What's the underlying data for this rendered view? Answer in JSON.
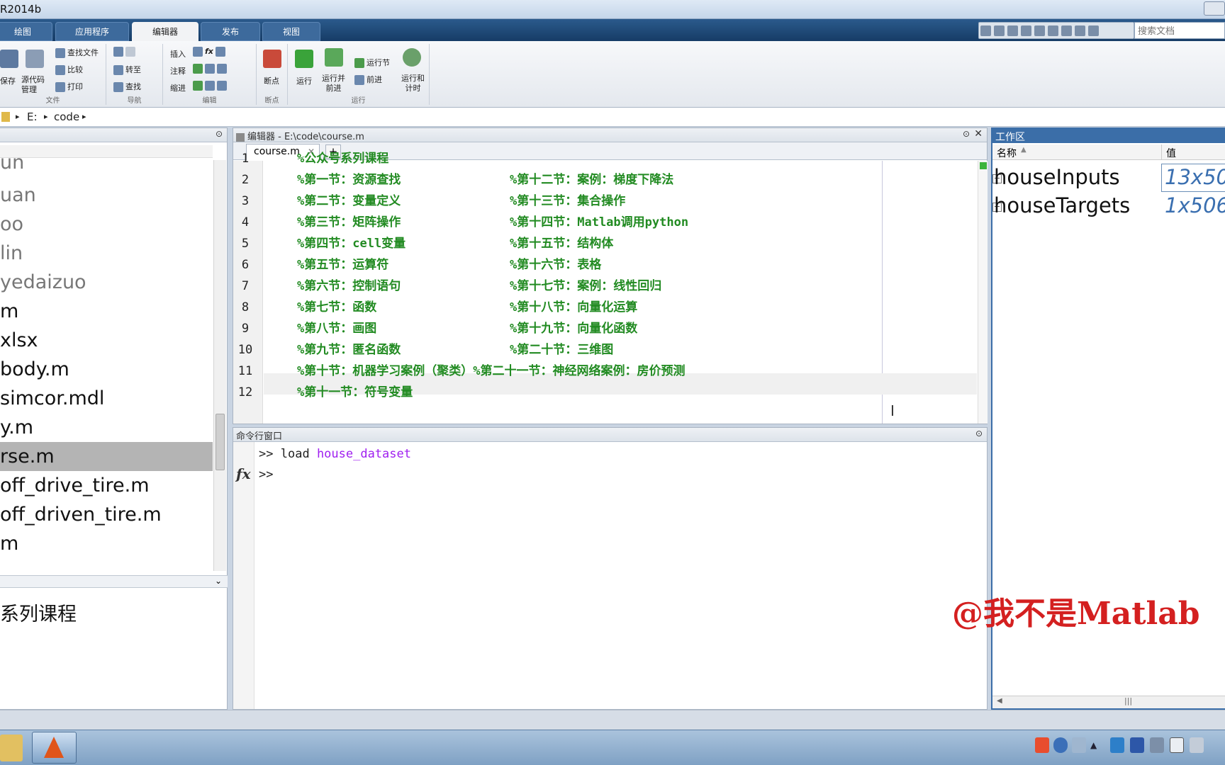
{
  "window": {
    "title": "R2014b"
  },
  "ribbon_tabs": [
    "绘图",
    "应用程序",
    "编辑器",
    "发布",
    "视图"
  ],
  "active_tab": "编辑器",
  "search": {
    "placeholder": "搜索文档"
  },
  "ribbon": {
    "file": {
      "label": "文件",
      "save": "保存",
      "source_control": "源代码\n管理",
      "find_files": "查找文件",
      "compare": "比较",
      "print": "打印"
    },
    "navigate": {
      "label": "导航",
      "goto": "转至",
      "find": "查找"
    },
    "edit": {
      "label": "编辑",
      "insert": "插入",
      "comment": "注释",
      "indent": "缩进",
      "fx": "fx"
    },
    "breakpoints": {
      "label": "断点",
      "breakpoints_btn": "断点"
    },
    "run": {
      "label": "运行",
      "run": "运行",
      "run_advance": "运行并\n前进",
      "run_section": "运行节",
      "advance": "前进",
      "run_time": "运行和\n计时"
    }
  },
  "address": {
    "drive": "E:",
    "folder": "code"
  },
  "files": [
    {
      "name": "un",
      "style": "gray"
    },
    {
      "name": "uan",
      "style": "gray"
    },
    {
      "name": "oo",
      "style": "gray"
    },
    {
      "name": "lin",
      "style": "gray"
    },
    {
      "name": "yedaizuo",
      "style": "gray"
    },
    {
      "name": "m",
      "style": ""
    },
    {
      "name": "xlsx",
      "style": ""
    },
    {
      "name": "body.m",
      "style": ""
    },
    {
      "name": "simcor.mdl",
      "style": ""
    },
    {
      "name": "y.m",
      "style": ""
    },
    {
      "name": "rse.m",
      "style": "sel"
    },
    {
      "name": "off_drive_tire.m",
      "style": ""
    },
    {
      "name": "off_driven_tire.m",
      "style": ""
    },
    {
      "name": "m",
      "style": ""
    }
  ],
  "details": {
    "text": "系列课程"
  },
  "editor": {
    "title": "编辑器 - E:\\code\\course.m",
    "tab": "course.m",
    "lines": [
      {
        "n": "1",
        "a": "%公众号系列课程",
        "b": ""
      },
      {
        "n": "2",
        "a": "%第一节：资源查找",
        "b": "%第十二节：案例：梯度下降法"
      },
      {
        "n": "3",
        "a": "%第二节：变量定义",
        "b": "%第十三节：集合操作"
      },
      {
        "n": "4",
        "a": "%第三节：矩阵操作",
        "b": "%第十四节：Matlab调用python"
      },
      {
        "n": "5",
        "a": "%第四节：cell变量",
        "b": "%第十五节：结构体"
      },
      {
        "n": "6",
        "a": "%第五节：运算符",
        "b": "%第十六节：表格"
      },
      {
        "n": "7",
        "a": "%第六节：控制语句",
        "b": "%第十七节：案例：线性回归"
      },
      {
        "n": "8",
        "a": "%第七节：函数",
        "b": "%第十八节：向量化运算"
      },
      {
        "n": "9",
        "a": "%第八节：画图",
        "b": "%第十九节：向量化函数"
      },
      {
        "n": "10",
        "a": "%第九节：匿名函数",
        "b": "%第二十节：三维图"
      },
      {
        "n": "11",
        "a": "%第十节：机器学习案例（聚类）%第二十一节：神经网络案例：房价预测",
        "b": ""
      },
      {
        "n": "12",
        "a": "%第十一节：符号变量",
        "b": ""
      }
    ]
  },
  "command_window": {
    "title": "命令行窗口",
    "prompt": ">>",
    "cmd": "load",
    "arg": "house_dataset",
    "fx": "fx"
  },
  "workspace": {
    "title": "工作区",
    "col_name": "名称",
    "col_value": "值",
    "vars": [
      {
        "name": "houseInputs",
        "value": "13x50"
      },
      {
        "name": "houseTargets",
        "value": "1x506"
      }
    ]
  },
  "watermark": "@我不是Matlab"
}
